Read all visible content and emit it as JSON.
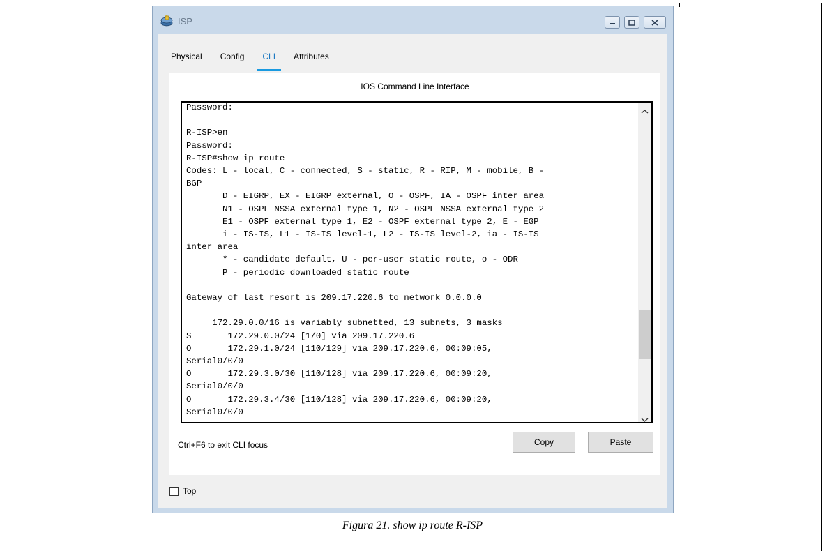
{
  "window": {
    "title": "ISP",
    "icon": "router-icon"
  },
  "tabs": [
    {
      "label": "Physical"
    },
    {
      "label": "Config"
    },
    {
      "label": "CLI",
      "active": true
    },
    {
      "label": "Attributes"
    }
  ],
  "panel": {
    "heading": "IOS Command Line Interface"
  },
  "cli": {
    "lines": [
      "Password:",
      "",
      "R-ISP>en",
      "Password:",
      "R-ISP#show ip route",
      "Codes: L - local, C - connected, S - static, R - RIP, M - mobile, B -",
      "BGP",
      "       D - EIGRP, EX - EIGRP external, O - OSPF, IA - OSPF inter area",
      "       N1 - OSPF NSSA external type 1, N2 - OSPF NSSA external type 2",
      "       E1 - OSPF external type 1, E2 - OSPF external type 2, E - EGP",
      "       i - IS-IS, L1 - IS-IS level-1, L2 - IS-IS level-2, ia - IS-IS",
      "inter area",
      "       * - candidate default, U - per-user static route, o - ODR",
      "       P - periodic downloaded static route",
      "",
      "Gateway of last resort is 209.17.220.6 to network 0.0.0.0",
      "",
      "     172.29.0.0/16 is variably subnetted, 13 subnets, 3 masks",
      "S       172.29.0.0/24 [1/0] via 209.17.220.6",
      "O       172.29.1.0/24 [110/129] via 209.17.220.6, 00:09:05,",
      "Serial0/0/0",
      "O       172.29.3.0/30 [110/128] via 209.17.220.6, 00:09:20,",
      "Serial0/0/0",
      "O       172.29.3.4/30 [110/128] via 209.17.220.6, 00:09:20,",
      "Serial0/0/0"
    ]
  },
  "footer": {
    "hint": "Ctrl+F6 to exit CLI focus",
    "copy_label": "Copy",
    "paste_label": "Paste"
  },
  "top_checkbox": {
    "label": "Top",
    "checked": false
  },
  "caption": "Figura 21. show ip route R-ISP",
  "colors": {
    "window_frame": "#c9d9ea",
    "tab_active": "#1a78c2",
    "tab_underline": "#1a9ae0"
  }
}
